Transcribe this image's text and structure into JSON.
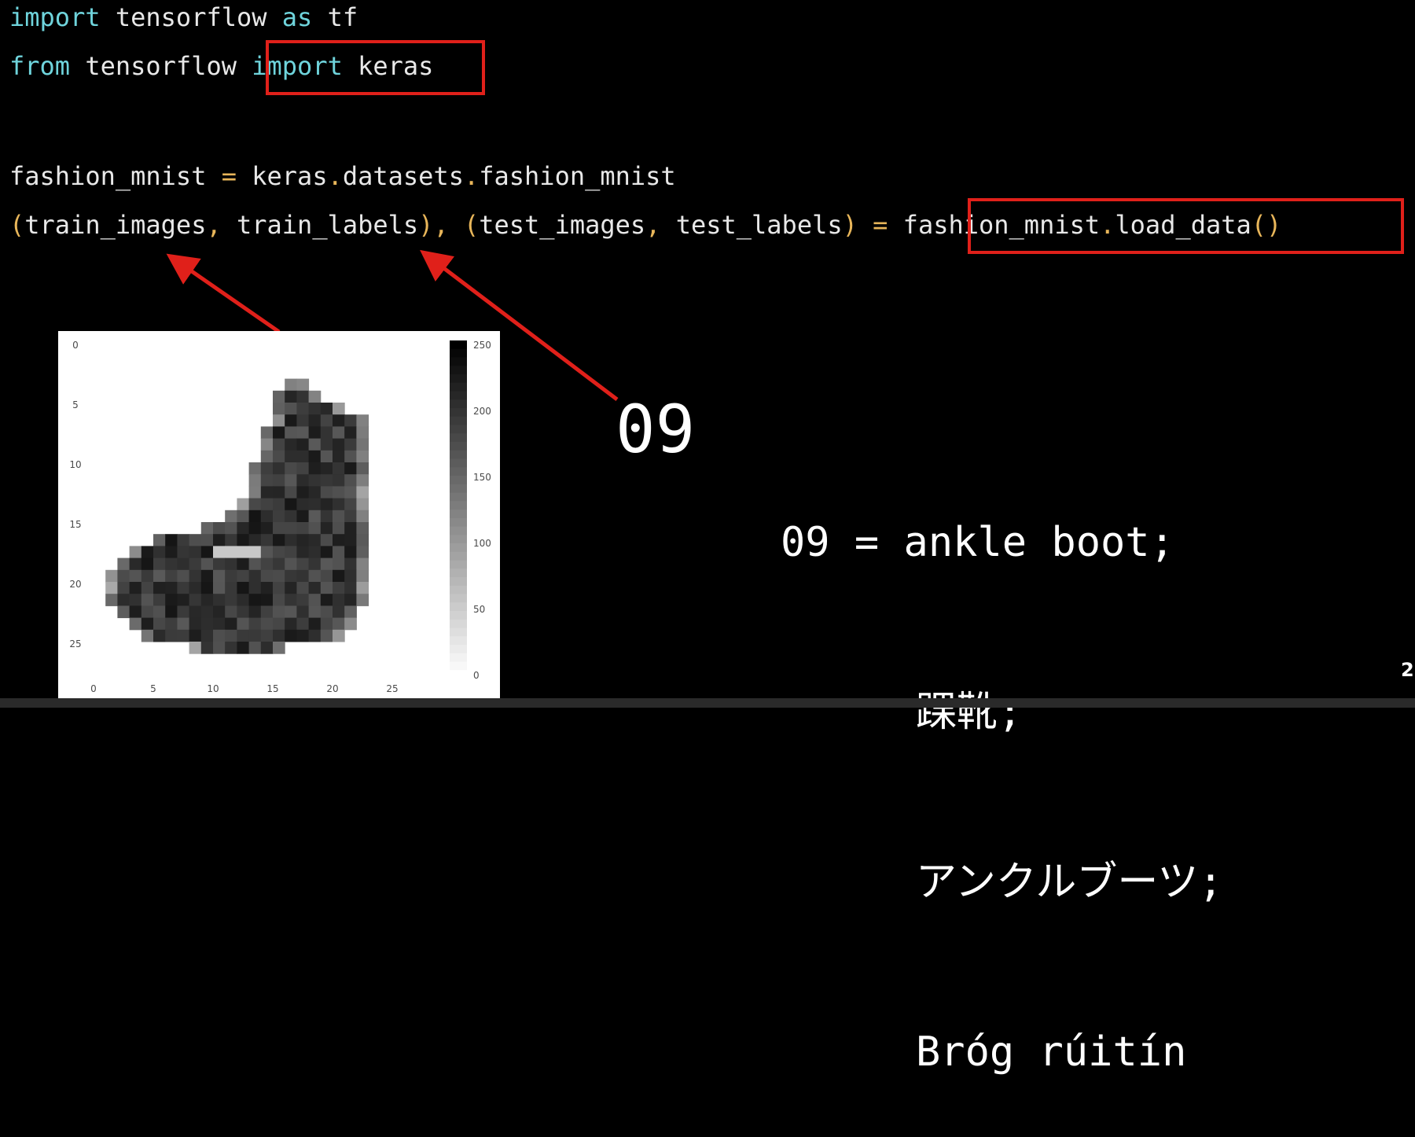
{
  "code": {
    "line1": {
      "kw1": "import",
      "t1": " tensorflow ",
      "kw2": "as",
      "t2": " tf"
    },
    "line2": {
      "kw1": "from",
      "t1": " tensorflow ",
      "kw2": "import",
      "t2": " keras"
    },
    "line3": {
      "t1": "fashion_mnist ",
      "op": "=",
      "t2": " keras",
      "d1": ".",
      "t3": "datasets",
      "d2": ".",
      "t4": "fashion_mnist"
    },
    "line4": {
      "p1": "(",
      "t1": "train_images",
      "c1": ",",
      "t2": " train_labels",
      "p2": ")",
      "c2": ",",
      "p3": " (",
      "t3": "test_images",
      "c3": ",",
      "t4": " test_labels",
      "p4": ")",
      "op": " =",
      "t5": " fashion_mnist",
      "d1": ".",
      "t6": "load_data",
      "p5": "()"
    }
  },
  "colors": {
    "keyword": "#6fd4dc",
    "punct": "#e8b65a",
    "highlight": "#e0201a",
    "text": "#e8e8e8"
  },
  "figure": {
    "axis_ticks_x": [
      "0",
      "5",
      "10",
      "15",
      "20",
      "25"
    ],
    "axis_ticks_y": [
      "0",
      "5",
      "10",
      "15",
      "20",
      "25"
    ],
    "colorbar_ticks": [
      "250",
      "200",
      "150",
      "100",
      "50",
      "0"
    ]
  },
  "label_number": "09",
  "label": {
    "prefix": "09 = ",
    "en": "ankle boot;",
    "zh": "踝靴;",
    "ja": "アンクルブーツ;",
    "ga": "Bróg rúitín"
  },
  "page_number": "2"
}
